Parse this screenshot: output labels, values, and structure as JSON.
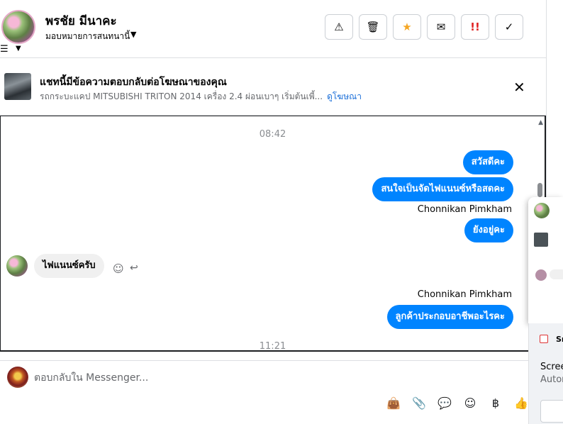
{
  "header": {
    "name": "พรชัย มีนาคะ",
    "assign_label": "มอบหมายการสนทนานี้",
    "actions": [
      {
        "icon": "warning-icon",
        "glyph": "⚠"
      },
      {
        "icon": "trash-icon",
        "glyph": "🗑"
      },
      {
        "icon": "star-icon",
        "glyph": "★"
      },
      {
        "icon": "envelope-icon",
        "glyph": "✉"
      },
      {
        "icon": "double-exclamation-icon",
        "glyph": "!!"
      },
      {
        "icon": "checkmark-icon",
        "glyph": "✓"
      }
    ]
  },
  "ad": {
    "title": "แชทนี้มีข้อความตอบกลับต่อโฆษณาของคุณ",
    "description": "รถกระบะแคป MITSUBISHI TRITON 2014 เครื่อง 2.4 ผ่อนเบาๆ เริ่มต้นเพี้...",
    "link": "ดูโฆษณา"
  },
  "chat": {
    "time_1": "08:42",
    "out_1": "สวัสดีคะ",
    "out_2": "สนใจเป็นจัดไฟแนนซ์หรือสดคะ",
    "sender_1": "Chonnikan Pimkham",
    "out_3": "ยังอยู่คะ",
    "in_1": "ไฟแนนซ์ครับ",
    "sender_2": "Chonnikan Pimkham",
    "out_4": "ลูกค้าประกอบอาชีพอะไรคะ",
    "time_2": "11:21"
  },
  "composer": {
    "placeholder": "ตอบกลับใน Messenger..."
  },
  "notification": {
    "title": "Sn",
    "line1": "Scree",
    "line2": "Autor"
  },
  "colors": {
    "accent": "#0084ff",
    "link": "#1a6ed8",
    "star": "#f5a623",
    "alert": "#e02424"
  }
}
